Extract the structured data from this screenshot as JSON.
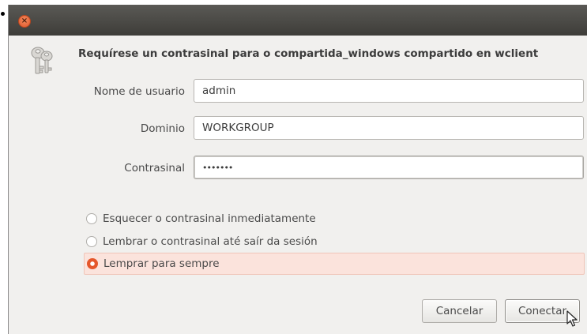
{
  "dialog": {
    "heading": "Requírese un contrasinal para o compartida_windows compartido en wclient"
  },
  "form": {
    "username": {
      "label": "Nome de usuario",
      "value": "admin"
    },
    "domain": {
      "label": "Dominio",
      "value": "WORKGROUP"
    },
    "password": {
      "label": "Contrasinal",
      "value": "•••••••"
    }
  },
  "remember": {
    "options": [
      {
        "label": "Esquecer o contrasinal inmediatamente",
        "selected": false
      },
      {
        "label": "Lembrar o contrasinal até saír da sesión",
        "selected": false
      },
      {
        "label": "Lemprar para sempre",
        "selected": true
      }
    ]
  },
  "buttons": {
    "cancel": "Cancelar",
    "connect": "Conectar"
  },
  "colors": {
    "titlebar": "#4a4945",
    "accent": "#e5572b",
    "selected_row": "#fbe3dc",
    "window_bg": "#f1f0ee"
  },
  "icons": {
    "close": "close-icon",
    "keys": "keys-icon",
    "pointer": "mouse-pointer-icon"
  }
}
